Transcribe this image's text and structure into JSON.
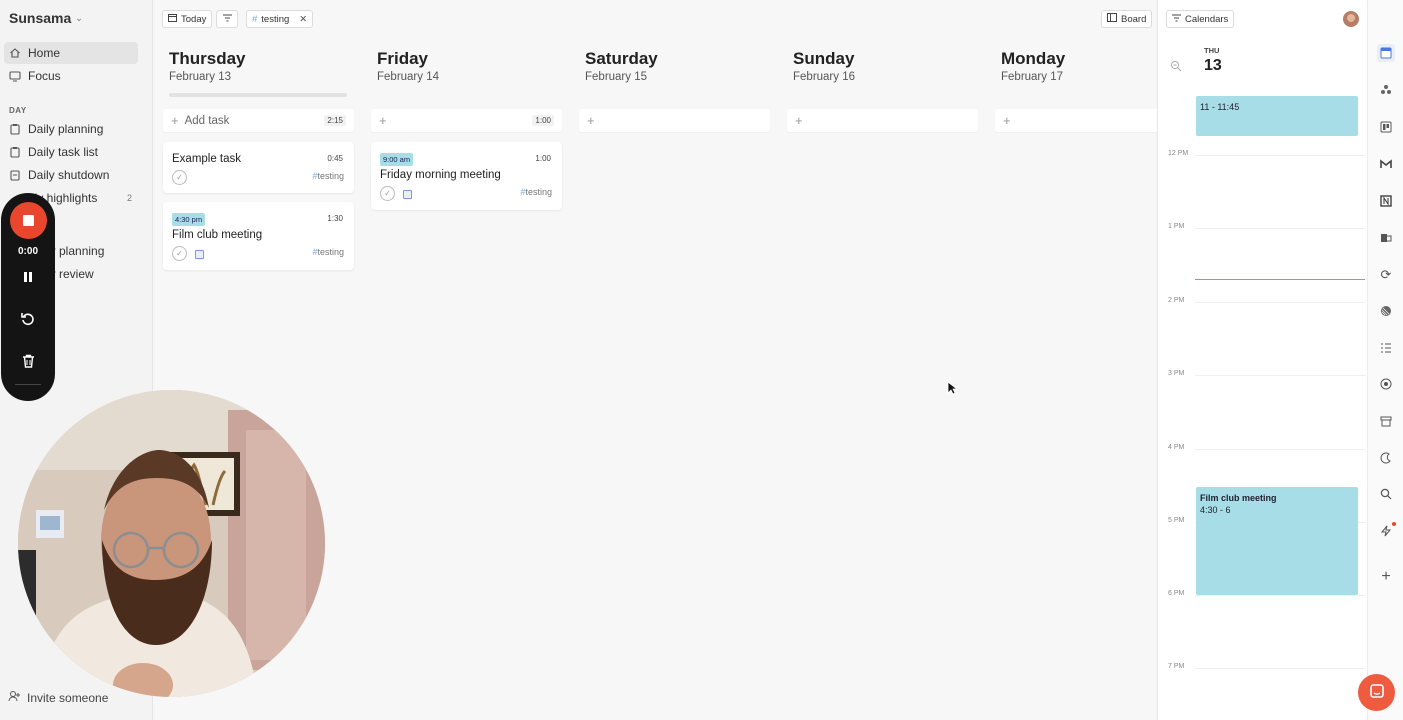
{
  "sidebar": {
    "workspace": "Sunsama",
    "home": "Home",
    "focus": "Focus",
    "day_section": "DAY",
    "items": [
      {
        "label": "Daily planning"
      },
      {
        "label": "Daily task list"
      },
      {
        "label": "Daily shutdown"
      },
      {
        "label": "ily highlights",
        "count": "2"
      },
      {
        "label": "ly planning"
      },
      {
        "label": "ly review"
      }
    ],
    "invite": "Invite someone"
  },
  "recorder": {
    "timer": "0:00"
  },
  "toolbar": {
    "today": "Today",
    "channel_filter": "testing",
    "board": "Board"
  },
  "columns": [
    {
      "day": "Thursday",
      "date": "February 13",
      "add_label": "Add task",
      "total": "2:15"
    },
    {
      "day": "Friday",
      "date": "February 14",
      "add_label": "",
      "total": "1:00"
    },
    {
      "day": "Saturday",
      "date": "February 15",
      "add_label": "",
      "total": ""
    },
    {
      "day": "Sunday",
      "date": "February 16",
      "add_label": "",
      "total": ""
    },
    {
      "day": "Monday",
      "date": "February 17",
      "add_label": "",
      "total": ""
    }
  ],
  "tasks": {
    "example": {
      "title": "Example task",
      "duration": "0:45",
      "channel": "testing"
    },
    "film": {
      "time": "4:30 pm",
      "title": "Film club meeting",
      "duration": "1:30",
      "channel": "testing"
    },
    "friday": {
      "time": "9:00 am",
      "title": "Friday morning meeting",
      "duration": "1:00",
      "channel": "testing"
    }
  },
  "calendar": {
    "button": "Calendars",
    "weekday": "THU",
    "day": "13",
    "hours": [
      "12 PM",
      "1 PM",
      "2 PM",
      "3 PM",
      "4 PM",
      "5 PM",
      "6 PM",
      "7 PM"
    ],
    "events": [
      {
        "title": "",
        "time": "11 - 11:45"
      },
      {
        "title": "Film club meeting",
        "time": "4:30 - 6"
      }
    ]
  },
  "colors": {
    "accent_red": "#e9472d",
    "event_blue": "#a6dde6",
    "now_line": "#e07b7b",
    "chat_button": "#ef5b3f"
  }
}
